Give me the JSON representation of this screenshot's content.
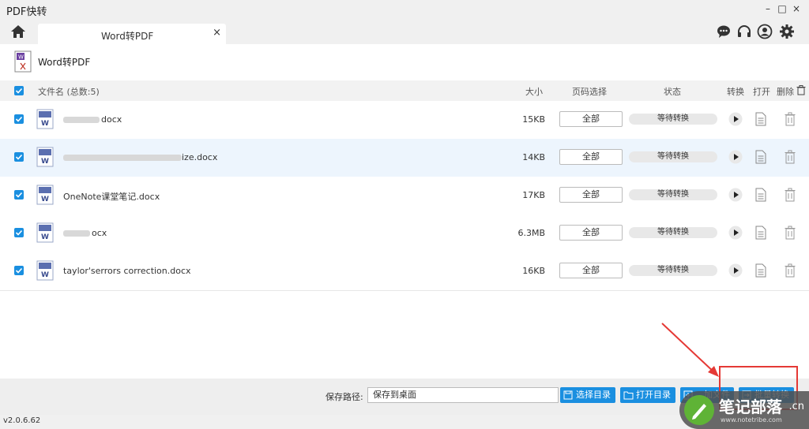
{
  "app": {
    "title": "PDF快转",
    "version": "v2.0.6.62"
  },
  "window": {
    "minimize": "–",
    "maximize": "□",
    "close": "×"
  },
  "tabs": [
    {
      "label": "Word转PDF",
      "close": "×"
    }
  ],
  "page": {
    "title": "Word转PDF"
  },
  "table": {
    "header": {
      "filename": "文件名 (总数:5)",
      "size": "大小",
      "pages": "页码选择",
      "status": "状态",
      "convert": "转换",
      "open": "打开",
      "delete": "删除"
    },
    "rows": [
      {
        "name": "docx",
        "size": "15KB",
        "pages": "全部",
        "status": "等待转换",
        "checked": true
      },
      {
        "name": "ize.docx",
        "size": "14KB",
        "pages": "全部",
        "status": "等待转换",
        "checked": true
      },
      {
        "name": "OneNote课堂笔记.docx",
        "size": "17KB",
        "pages": "全部",
        "status": "等待转换",
        "checked": true
      },
      {
        "name": "ocx",
        "size": "6.3MB",
        "pages": "全部",
        "status": "等待转换",
        "checked": true
      },
      {
        "name": "taylor'serrors correction.docx",
        "size": "16KB",
        "pages": "全部",
        "status": "等待转换",
        "checked": true
      }
    ]
  },
  "footer": {
    "save_label": "保存路径:",
    "save_value": "保存到桌面",
    "choose_dir": "选择目录",
    "open_dir": "打开目录",
    "add_file": "加文件",
    "batch_convert": "批量转换"
  },
  "watermark": {
    "text": "笔记部落",
    "suffix": ".cn",
    "url": "www.notetribe.com"
  },
  "colors": {
    "accent": "#1a8fe0",
    "highlight_box": "#e53935"
  }
}
